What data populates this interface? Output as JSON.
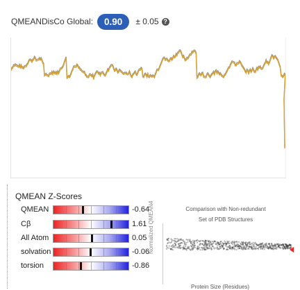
{
  "global": {
    "label": "QMEANDisCo Global:",
    "score": "0.90",
    "error": "± 0.05",
    "help_glyph": "?"
  },
  "local_plot": {
    "colors": {
      "line": "#e0a020",
      "shadow": "#999999"
    }
  },
  "zscores": {
    "title": "QMEAN Z-Scores",
    "rows": [
      {
        "label": "QMEAN",
        "value": "-0.64",
        "z": -0.64
      },
      {
        "label": "Cβ",
        "value": "1.61",
        "z": 1.61
      },
      {
        "label": "All Atom",
        "value": "0.05",
        "z": 0.05
      },
      {
        "label": "solvation",
        "value": "-0.06",
        "z": -0.06
      },
      {
        "label": "torsion",
        "value": "-0.86",
        "z": -0.86
      }
    ]
  },
  "comparison": {
    "title_line1": "Comparison with Non-redundant",
    "title_line2": "Set of PDB Structures",
    "ylabel": "Normalized QMEAN4",
    "xlabel": "Protein Size (Residues)",
    "colors": {
      "cloud": "#333333",
      "marker": "#ff2020"
    }
  }
}
